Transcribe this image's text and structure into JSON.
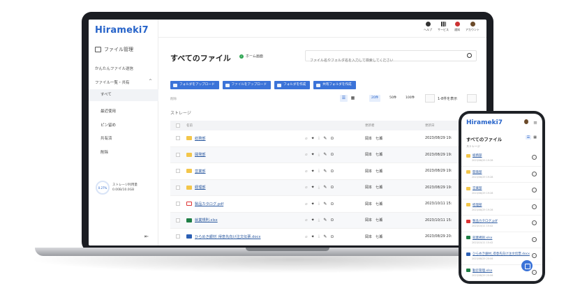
{
  "app": {
    "logo": "Hirameki",
    "logo_num": "7"
  },
  "header": {
    "icons": [
      {
        "label": "ヘルプ",
        "icon": "help-icon"
      },
      {
        "label": "サービス",
        "icon": "grid-icon"
      },
      {
        "label": "通知",
        "icon": "bell-icon"
      },
      {
        "label": "アカウント",
        "icon": "account-icon"
      }
    ]
  },
  "sidebar": {
    "main": "ファイル管理",
    "easy_send": "かんたんファイル送信",
    "list_share": "ファイル一覧・共有",
    "sub": [
      "すべて",
      "最近使用",
      "ピン留め",
      "共有済",
      "削除"
    ],
    "storage_label": "ストレージ利用量",
    "storage_value": "0.00B/10.0GB",
    "storage_percent": "0.27%"
  },
  "main": {
    "title": "すべてのファイル",
    "home_badge": "ホーム画面",
    "search_placeholder": "ファイル名やフォルダ名を入力して検索してください",
    "buttons": [
      "フォルダをアップロード",
      "ファイルをアップロード",
      "フォルダを作成",
      "共有フォルダを作成"
    ],
    "sort_label": "削除",
    "per_page": [
      "20件",
      "50件",
      "100件"
    ],
    "range": "1-8件を表示",
    "section": "ストレージ",
    "columns": {
      "name": "名前",
      "owner": "更新者",
      "date": "更新日"
    }
  },
  "files": [
    {
      "name": "総務部",
      "type": "folder",
      "owner": "岡本　七瀬",
      "date": "2023/08/29 19:"
    },
    {
      "name": "開発部",
      "type": "folder",
      "owner": "岡本　七瀬",
      "date": "2023/08/29 19:"
    },
    {
      "name": "営業部",
      "type": "folder",
      "owner": "岡本　七瀬",
      "date": "2023/08/29 19:"
    },
    {
      "name": "経理部",
      "type": "folder",
      "owner": "岡本　七瀬",
      "date": "2023/08/29 19:"
    },
    {
      "name": "製品カタログ.pdf",
      "type": "pdf",
      "owner": "岡本　七瀬",
      "date": "2023/10/11 15:"
    },
    {
      "name": "就業規則.xlsx",
      "type": "xls",
      "owner": "岡本　七瀬",
      "date": "2023/10/11 15:"
    },
    {
      "name": "ひらめき銀材_得意先向け注文伝票.docx",
      "type": "doc",
      "owner": "岡本　七瀬",
      "date": "2023/08/29 20:"
    }
  ],
  "phone": {
    "title": "すべてのファイル",
    "storage": "ストレージ",
    "rows": [
      {
        "name": "総務部",
        "type": "folder",
        "date": "2023/08/29 19:28"
      },
      {
        "name": "開発部",
        "type": "folder",
        "date": "2023/08/29 19:28"
      },
      {
        "name": "営業部",
        "type": "folder",
        "date": "2023/08/29 19:28"
      },
      {
        "name": "経理部",
        "type": "folder",
        "date": "2023/08/29 19:28"
      },
      {
        "name": "製品カタログ.pdf",
        "type": "pdf",
        "date": "2023/10/11 15:42"
      },
      {
        "name": "就業規則.xlsx",
        "type": "xls",
        "date": "2023/10/11 15:42"
      },
      {
        "name": "ひらめき銀材_得意先向け注文伝票.docx",
        "type": "doc",
        "date": "2023/08/29 20:06"
      },
      {
        "name": "勤怠管理.xlsx",
        "type": "xls",
        "date": "2023/08/29 20:06"
      }
    ]
  },
  "colors": {
    "accent": "#3b73d8",
    "logo": "#2663c9",
    "folder": "#f3c64a"
  }
}
